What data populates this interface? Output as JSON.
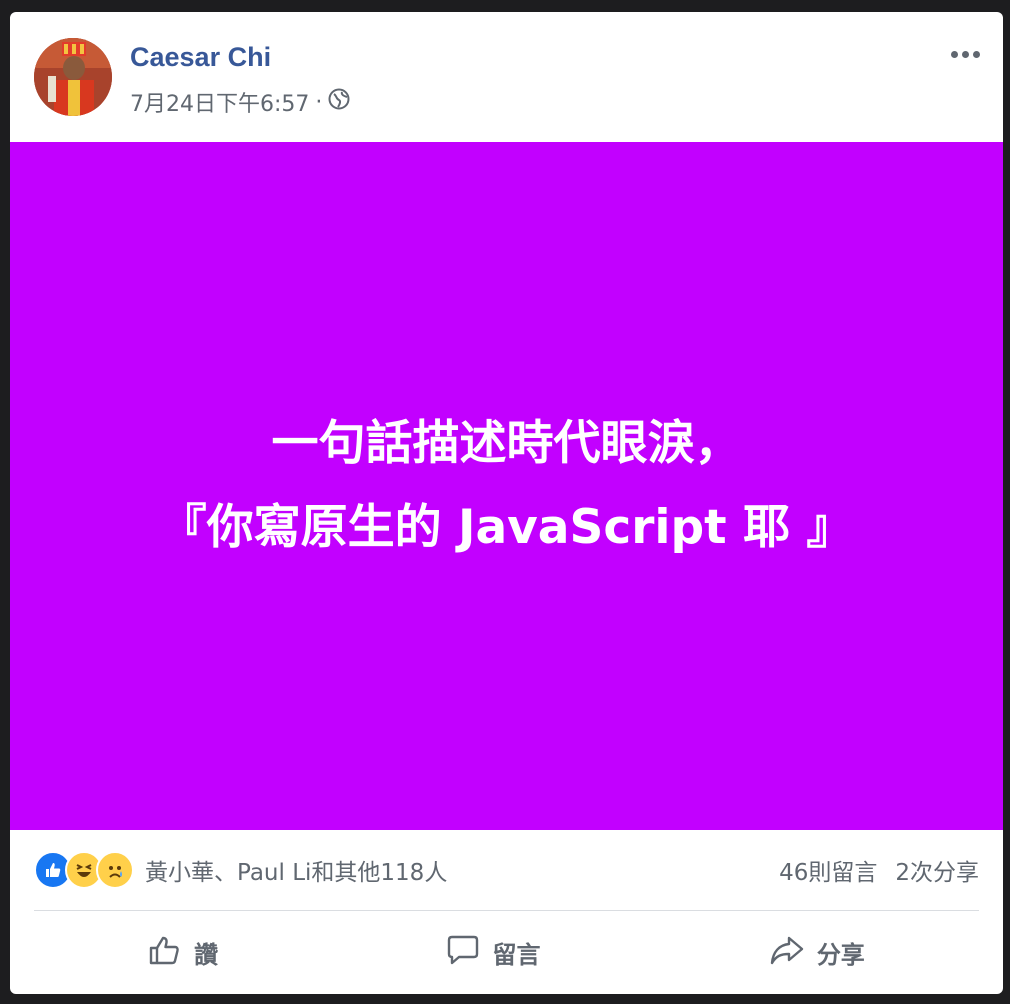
{
  "post": {
    "author": "Caesar Chi",
    "timestamp": "7月24日下午6:57",
    "separator": "·",
    "privacy_icon": "globe-icon",
    "more_icon": "more-options-icon",
    "background_color": "#c200ff",
    "text_line_1": "一句話描述時代眼淚，",
    "text_line_2": "『你寫原生的 JavaScript 耶 』"
  },
  "reactions": {
    "icons": [
      "like-icon",
      "haha-icon",
      "sad-icon"
    ],
    "names": "黃小華、Paul Li和其他118人",
    "comments": "46則留言",
    "shares": "2次分享"
  },
  "actions": {
    "like": "讚",
    "comment": "留言",
    "share": "分享"
  },
  "colors": {
    "link": "#385898",
    "like_blue": "#1877f2",
    "emoji_yellow": "#ffd04a",
    "muted_text": "#606770"
  }
}
